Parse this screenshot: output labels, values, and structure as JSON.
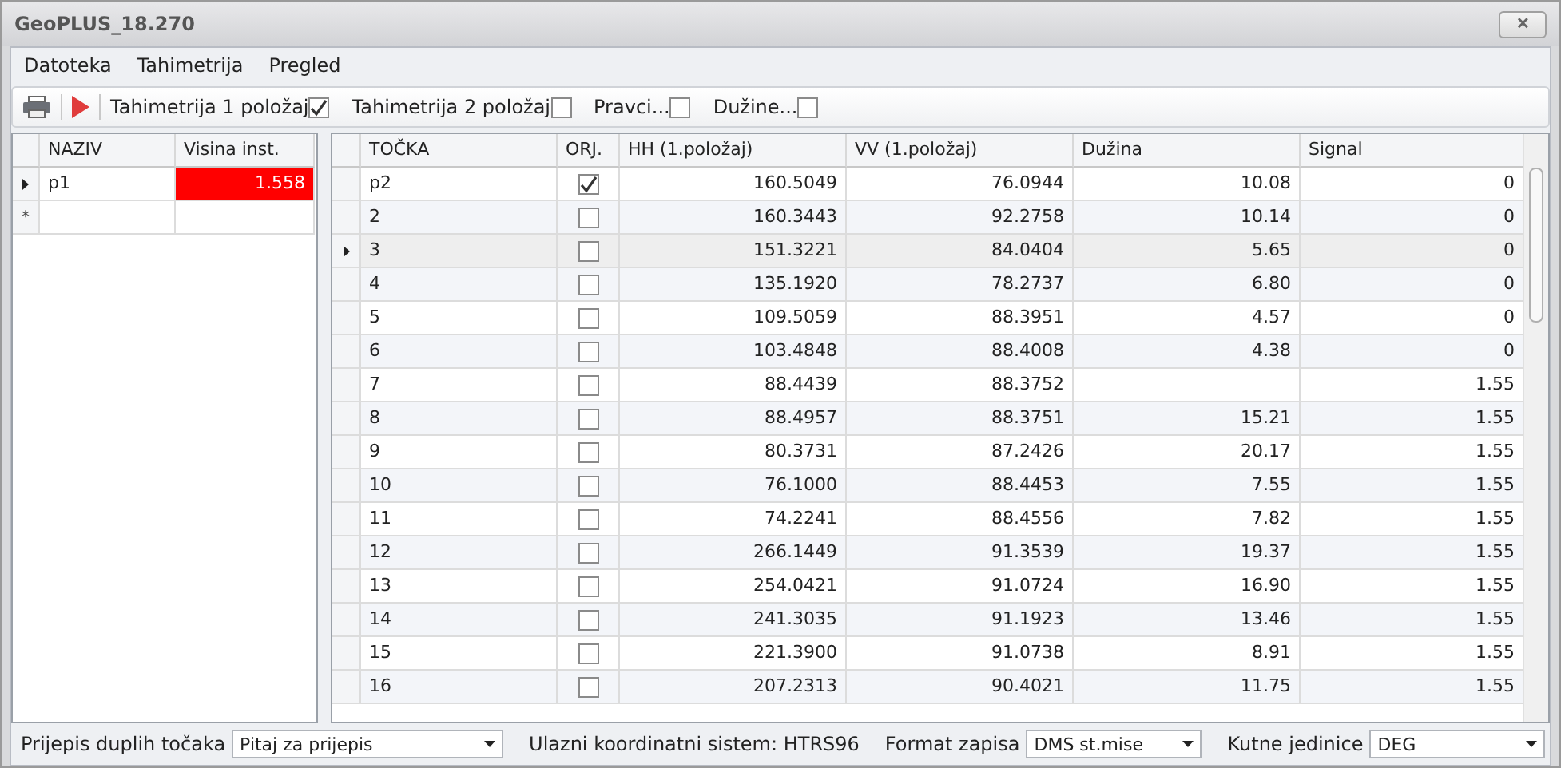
{
  "window": {
    "title": "GeoPLUS_18.270",
    "close": "✕"
  },
  "menu": [
    "Datoteka",
    "Tahimetrija",
    "Pregled"
  ],
  "toolbar": {
    "checks": [
      {
        "label": "Tahimetrija 1 položaj",
        "checked": true
      },
      {
        "label": "Tahimetrija 2 položaj",
        "checked": false
      },
      {
        "label": "Pravci...",
        "checked": false
      },
      {
        "label": "Dužine...",
        "checked": false
      }
    ]
  },
  "stations": {
    "columns": [
      "NAZIV",
      "Visina inst."
    ],
    "rows": [
      {
        "naziv": "p1",
        "visina": "1.558",
        "current": true,
        "invalid": true
      }
    ],
    "new_row_marker": "*"
  },
  "points": {
    "columns": [
      "TOČKA",
      "ORJ.",
      "HH (1.položaj)",
      "VV (1.položaj)",
      "Dužina",
      "Signal"
    ],
    "rows": [
      {
        "tocka": "p2",
        "orj": true,
        "hh": "160.5049",
        "vv": "76.0944",
        "duzina": "10.08",
        "signal": "0",
        "current": false
      },
      {
        "tocka": "2",
        "orj": false,
        "hh": "160.3443",
        "vv": "92.2758",
        "duzina": "10.14",
        "signal": "0",
        "current": false
      },
      {
        "tocka": "3",
        "orj": false,
        "hh": "151.3221",
        "vv": "84.0404",
        "duzina": "5.65",
        "signal": "0",
        "current": true
      },
      {
        "tocka": "4",
        "orj": false,
        "hh": "135.1920",
        "vv": "78.2737",
        "duzina": "6.80",
        "signal": "0",
        "current": false
      },
      {
        "tocka": "5",
        "orj": false,
        "hh": "109.5059",
        "vv": "88.3951",
        "duzina": "4.57",
        "signal": "0",
        "current": false
      },
      {
        "tocka": "6",
        "orj": false,
        "hh": "103.4848",
        "vv": "88.4008",
        "duzina": "4.38",
        "signal": "0",
        "current": false
      },
      {
        "tocka": "7",
        "orj": false,
        "hh": "88.4439",
        "vv": "88.3752",
        "signal": "1.55",
        "current": false
      },
      {
        "tocka": "8",
        "orj": false,
        "hh": "88.4957",
        "vv": "88.3751",
        "duzina": "15.21",
        "signal": "1.55",
        "current": false
      },
      {
        "tocka": "9",
        "orj": false,
        "hh": "80.3731",
        "vv": "87.2426",
        "duzina": "20.17",
        "signal": "1.55",
        "current": false
      },
      {
        "tocka": "10",
        "orj": false,
        "hh": "76.1000",
        "vv": "88.4453",
        "duzina": "7.55",
        "signal": "1.55",
        "current": false
      },
      {
        "tocka": "11",
        "orj": false,
        "hh": "74.2241",
        "vv": "88.4556",
        "duzina": "7.82",
        "signal": "1.55",
        "current": false
      },
      {
        "tocka": "12",
        "orj": false,
        "hh": "266.1449",
        "vv": "91.3539",
        "duzina": "19.37",
        "signal": "1.55",
        "current": false
      },
      {
        "tocka": "13",
        "orj": false,
        "hh": "254.0421",
        "vv": "91.0724",
        "duzina": "16.90",
        "signal": "1.55",
        "current": false
      },
      {
        "tocka": "14",
        "orj": false,
        "hh": "241.3035",
        "vv": "91.1923",
        "duzina": "13.46",
        "signal": "1.55",
        "current": false
      },
      {
        "tocka": "15",
        "orj": false,
        "hh": "221.3900",
        "vv": "91.0738",
        "duzina": "8.91",
        "signal": "1.55",
        "current": false
      },
      {
        "tocka": "16",
        "orj": false,
        "hh": "207.2313",
        "vv": "90.4021",
        "duzina": "11.75",
        "signal": "1.55",
        "current": false
      }
    ]
  },
  "status_bar": [
    {
      "label": "Prijepis duplih točaka",
      "value": "Pitaj za prijepis",
      "wide": true
    },
    {
      "label": "Ulazni koordinatni sistem: HTRS96"
    },
    {
      "label": "Format zapisa",
      "value": "DMS st.mise",
      "wide": false
    },
    {
      "label": "Kutne jedinice",
      "value": "DEG",
      "wide": false
    }
  ]
}
